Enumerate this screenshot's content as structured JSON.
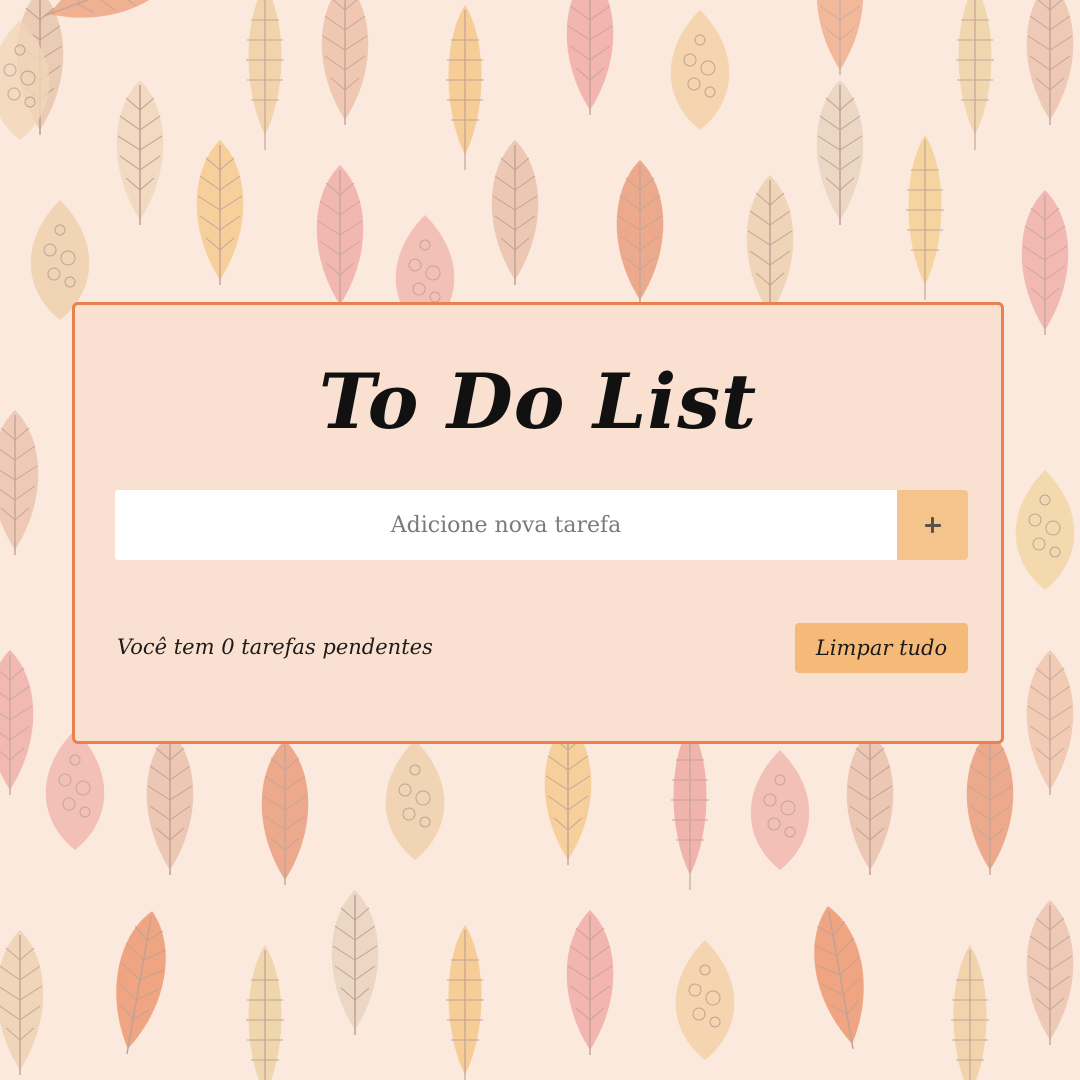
{
  "app": {
    "title": "To Do List"
  },
  "input": {
    "placeholder": "Adicione nova tarefa",
    "value": ""
  },
  "add_button": {
    "icon": "plus-icon"
  },
  "footer": {
    "pending_text": "Você tem 0 tarefas pendentes",
    "clear_label": "Limpar tudo"
  },
  "colors": {
    "background": "#fbe9dd",
    "card": "#f9e0d0",
    "card_border": "#e8814e",
    "add_button": "#f5c48d",
    "clear_button": "#f5b978"
  },
  "background_pattern": {
    "icon": "autumn-leaves-pattern"
  }
}
